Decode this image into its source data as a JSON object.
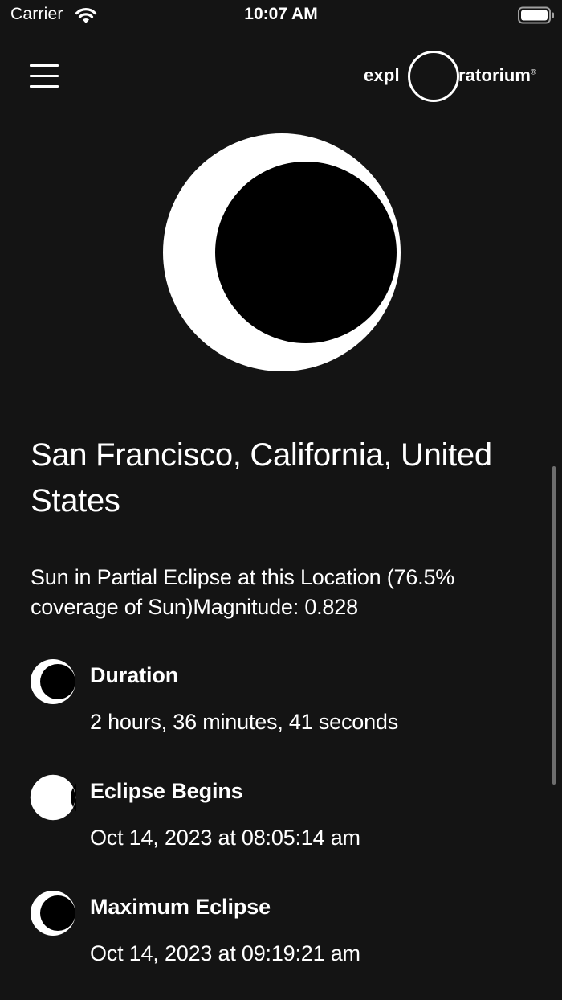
{
  "status_bar": {
    "carrier": "Carrier",
    "time": "10:07 AM",
    "wifi_icon": "wifi-icon",
    "battery_icon": "battery-icon"
  },
  "header": {
    "menu_icon": "hamburger-menu-icon",
    "logo": {
      "text_left": "expl",
      "text_right": "ratorium",
      "registered": "®"
    }
  },
  "hero": {
    "icon": "partial-eclipse-icon"
  },
  "location": {
    "name": "San Francisco, California, United States"
  },
  "summary": {
    "text": "Sun in Partial Eclipse at this Location (76.5% coverage of Sun)Magnitude: 0.828"
  },
  "details": [
    {
      "title": "Duration",
      "value": "2 hours, 36 minutes, 41 seconds",
      "icon": "eclipse-phase-icon"
    },
    {
      "title": "Eclipse Begins",
      "value": "Oct 14, 2023 at 08:05:14 am",
      "icon": "eclipse-begin-icon"
    },
    {
      "title": "Maximum Eclipse",
      "value": "Oct 14, 2023 at 09:19:21 am",
      "icon": "eclipse-max-icon"
    }
  ],
  "colors": {
    "background": "#141414",
    "text": "#ffffff",
    "moon": "#000000",
    "scrollbar": "#6e6e6e"
  }
}
